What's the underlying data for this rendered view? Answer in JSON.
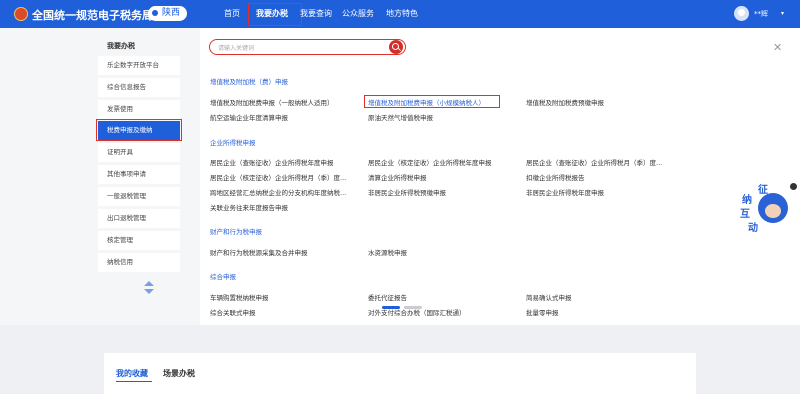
{
  "header": {
    "title": "全国统一规范电子税务局",
    "region": "陕西",
    "nav": [
      "首页",
      "我要办税",
      "我要查询",
      "公众服务",
      "地方特色"
    ],
    "user": "**辉"
  },
  "sidebar": {
    "title": "我要办税",
    "items": [
      "乐企数字开放平台",
      "综合信息报告",
      "发票使用",
      "税费申报及缴纳",
      "证明开具",
      "其他事项申请",
      "一般退税管理",
      "出口退税管理",
      "核定管理",
      "纳税信用"
    ],
    "active": "税费申报及缴纳"
  },
  "search": {
    "placeholder": "请输入关键词"
  },
  "sections": [
    {
      "title": "增值税及附加税（费）申报",
      "items": [
        "增值税及附加税费申报（一般纳税人适用）",
        "增值税及附加税费申报（小规模纳税人）",
        "增值税及附加税费预缴申报",
        "航空运输企业年度清算申报",
        "原油天然气增值税申报"
      ]
    },
    {
      "title": "企业所得税申报",
      "items": [
        "居民企业（查账征收）企业所得税年度申报",
        "居民企业（核定征收）企业所得税年度申报",
        "居民企业（查账征收）企业所得税月（季）度...",
        "居民企业（核定征收）企业所得税月（季）度...",
        "清算企业所得税申报",
        "扣缴企业所得税报告",
        "跨地区经营汇总纳税企业的分支机构年度纳税...",
        "非居民企业所得税预缴申报",
        "非居民企业所得税年度申报",
        "关联业务往来年度报告申报"
      ]
    },
    {
      "title": "财产和行为税申报",
      "items": [
        "财产和行为税税源采集及合并申报",
        "水资源税申报"
      ]
    },
    {
      "title": "综合申报",
      "items": [
        "车辆购置税纳税申报",
        "委托代征报告",
        "简易确认式申报",
        "综合关联式申报",
        "对外支付综合办税（国际汇税通）",
        "批量零申报"
      ]
    }
  ],
  "bottom_tabs": [
    "我的收藏",
    "场景办税"
  ],
  "widget": {
    "chars": [
      "征",
      "纳",
      "互",
      "动"
    ]
  },
  "colors": {
    "brand": "#1f5fd9",
    "highlight": "#e0302b",
    "link": "#2a62d6"
  }
}
